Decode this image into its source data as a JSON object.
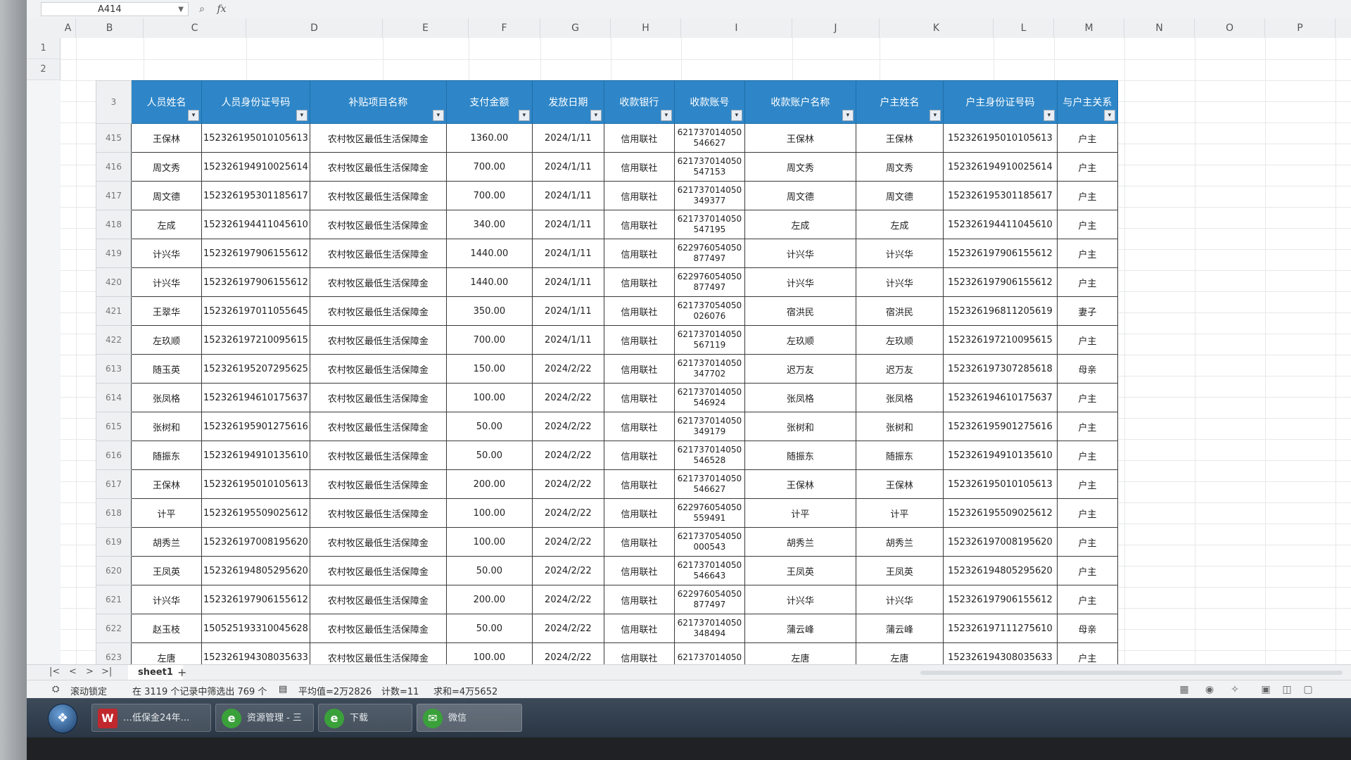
{
  "formula_bar": {
    "name_box": "A414",
    "zoom_icon": "magnifier-icon",
    "fx_label": "fx"
  },
  "columns": [
    "A",
    "B",
    "C",
    "D",
    "E",
    "F",
    "G",
    "H",
    "I",
    "J",
    "K",
    "L",
    "M",
    "N",
    "O",
    "P"
  ],
  "row_headers_top": [
    "1",
    "2",
    "3"
  ],
  "table": {
    "headers": [
      "人员姓名",
      "人员身份证号码",
      "补贴项目名称",
      "支付金额",
      "发放日期",
      "收款银行",
      "收款账号",
      "收款账户名称",
      "户主姓名",
      "户主身份证号码",
      "与户主关系"
    ],
    "rows": [
      {
        "rn": "415",
        "name": "王保林",
        "id": "152326195010105613",
        "item": "农村牧区最低生活保障金",
        "amount": "1360.00",
        "date": "2024/1/11",
        "bank": "信用联社",
        "acct1": "621737014050",
        "acct2": "546627",
        "acct_name": "王保林",
        "head": "王保林",
        "head_id": "152326195010105613",
        "rel": "户主"
      },
      {
        "rn": "416",
        "name": "周文秀",
        "id": "152326194910025614",
        "item": "农村牧区最低生活保障金",
        "amount": "700.00",
        "date": "2024/1/11",
        "bank": "信用联社",
        "acct1": "621737014050",
        "acct2": "547153",
        "acct_name": "周文秀",
        "head": "周文秀",
        "head_id": "152326194910025614",
        "rel": "户主"
      },
      {
        "rn": "417",
        "name": "周文德",
        "id": "152326195301185617",
        "item": "农村牧区最低生活保障金",
        "amount": "700.00",
        "date": "2024/1/11",
        "bank": "信用联社",
        "acct1": "621737014050",
        "acct2": "349377",
        "acct_name": "周文德",
        "head": "周文德",
        "head_id": "152326195301185617",
        "rel": "户主"
      },
      {
        "rn": "418",
        "name": "左成",
        "id": "152326194411045610",
        "item": "农村牧区最低生活保障金",
        "amount": "340.00",
        "date": "2024/1/11",
        "bank": "信用联社",
        "acct1": "621737014050",
        "acct2": "547195",
        "acct_name": "左成",
        "head": "左成",
        "head_id": "152326194411045610",
        "rel": "户主"
      },
      {
        "rn": "419",
        "name": "计兴华",
        "id": "152326197906155612",
        "item": "农村牧区最低生活保障金",
        "amount": "1440.00",
        "date": "2024/1/11",
        "bank": "信用联社",
        "acct1": "622976054050",
        "acct2": "877497",
        "acct_name": "计兴华",
        "head": "计兴华",
        "head_id": "152326197906155612",
        "rel": "户主"
      },
      {
        "rn": "420",
        "name": "计兴华",
        "id": "152326197906155612",
        "item": "农村牧区最低生活保障金",
        "amount": "1440.00",
        "date": "2024/1/11",
        "bank": "信用联社",
        "acct1": "622976054050",
        "acct2": "877497",
        "acct_name": "计兴华",
        "head": "计兴华",
        "head_id": "152326197906155612",
        "rel": "户主"
      },
      {
        "rn": "421",
        "name": "王翠华",
        "id": "152326197011055645",
        "item": "农村牧区最低生活保障金",
        "amount": "350.00",
        "date": "2024/1/11",
        "bank": "信用联社",
        "acct1": "621737054050",
        "acct2": "026076",
        "acct_name": "宿洪民",
        "head": "宿洪民",
        "head_id": "152326196811205619",
        "rel": "妻子"
      },
      {
        "rn": "422",
        "name": "左玖顺",
        "id": "152326197210095615",
        "item": "农村牧区最低生活保障金",
        "amount": "700.00",
        "date": "2024/1/11",
        "bank": "信用联社",
        "acct1": "621737014050",
        "acct2": "567119",
        "acct_name": "左玖顺",
        "head": "左玖顺",
        "head_id": "152326197210095615",
        "rel": "户主"
      },
      {
        "rn": "613",
        "name": "随玉英",
        "id": "152326195207295625",
        "item": "农村牧区最低生活保障金",
        "amount": "150.00",
        "date": "2024/2/22",
        "bank": "信用联社",
        "acct1": "621737014050",
        "acct2": "347702",
        "acct_name": "迟万友",
        "head": "迟万友",
        "head_id": "152326197307285618",
        "rel": "母亲"
      },
      {
        "rn": "614",
        "name": "张凤格",
        "id": "152326194610175637",
        "item": "农村牧区最低生活保障金",
        "amount": "100.00",
        "date": "2024/2/22",
        "bank": "信用联社",
        "acct1": "621737014050",
        "acct2": "546924",
        "acct_name": "张凤格",
        "head": "张凤格",
        "head_id": "152326194610175637",
        "rel": "户主"
      },
      {
        "rn": "615",
        "name": "张树和",
        "id": "152326195901275616",
        "item": "农村牧区最低生活保障金",
        "amount": "50.00",
        "date": "2024/2/22",
        "bank": "信用联社",
        "acct1": "621737014050",
        "acct2": "349179",
        "acct_name": "张树和",
        "head": "张树和",
        "head_id": "152326195901275616",
        "rel": "户主"
      },
      {
        "rn": "616",
        "name": "随振东",
        "id": "152326194910135610",
        "item": "农村牧区最低生活保障金",
        "amount": "50.00",
        "date": "2024/2/22",
        "bank": "信用联社",
        "acct1": "621737014050",
        "acct2": "546528",
        "acct_name": "随振东",
        "head": "随振东",
        "head_id": "152326194910135610",
        "rel": "户主"
      },
      {
        "rn": "617",
        "name": "王保林",
        "id": "152326195010105613",
        "item": "农村牧区最低生活保障金",
        "amount": "200.00",
        "date": "2024/2/22",
        "bank": "信用联社",
        "acct1": "621737014050",
        "acct2": "546627",
        "acct_name": "王保林",
        "head": "王保林",
        "head_id": "152326195010105613",
        "rel": "户主"
      },
      {
        "rn": "618",
        "name": "计平",
        "id": "152326195509025612",
        "item": "农村牧区最低生活保障金",
        "amount": "100.00",
        "date": "2024/2/22",
        "bank": "信用联社",
        "acct1": "622976054050",
        "acct2": "559491",
        "acct_name": "计平",
        "head": "计平",
        "head_id": "152326195509025612",
        "rel": "户主"
      },
      {
        "rn": "619",
        "name": "胡秀兰",
        "id": "152326197008195620",
        "item": "农村牧区最低生活保障金",
        "amount": "100.00",
        "date": "2024/2/22",
        "bank": "信用联社",
        "acct1": "621737054050",
        "acct2": "000543",
        "acct_name": "胡秀兰",
        "head": "胡秀兰",
        "head_id": "152326197008195620",
        "rel": "户主"
      },
      {
        "rn": "620",
        "name": "王凤英",
        "id": "152326194805295620",
        "item": "农村牧区最低生活保障金",
        "amount": "50.00",
        "date": "2024/2/22",
        "bank": "信用联社",
        "acct1": "621737014050",
        "acct2": "546643",
        "acct_name": "王凤英",
        "head": "王凤英",
        "head_id": "152326194805295620",
        "rel": "户主"
      },
      {
        "rn": "621",
        "name": "计兴华",
        "id": "152326197906155612",
        "item": "农村牧区最低生活保障金",
        "amount": "200.00",
        "date": "2024/2/22",
        "bank": "信用联社",
        "acct1": "622976054050",
        "acct2": "877497",
        "acct_name": "计兴华",
        "head": "计兴华",
        "head_id": "152326197906155612",
        "rel": "户主"
      },
      {
        "rn": "622",
        "name": "赵玉枝",
        "id": "150525193310045628",
        "item": "农村牧区最低生活保障金",
        "amount": "50.00",
        "date": "2024/2/22",
        "bank": "信用联社",
        "acct1": "621737014050",
        "acct2": "348494",
        "acct_name": "蒲云峰",
        "head": "蒲云峰",
        "head_id": "152326197111275610",
        "rel": "母亲"
      },
      {
        "rn": "623",
        "name": "左唐",
        "id": "152326194308035633",
        "item": "农村牧区最低生活保障金",
        "amount": "100.00",
        "date": "2024/2/22",
        "bank": "信用联社",
        "acct1": "621737014050",
        "acct2": "",
        "acct_name": "左唐",
        "head": "左唐",
        "head_id": "152326194308035633",
        "rel": "户主"
      }
    ]
  },
  "sheet_tabs": {
    "active": "sheet1",
    "add_label": "+",
    "nav": [
      "|<",
      "<",
      ">",
      ">|"
    ]
  },
  "status_bar": {
    "mode": "滚动锁定",
    "filter_info": "在 3119 个记录中筛选出 769 个",
    "average": "平均值=2万2826",
    "count": "计数=11",
    "sum": "求和=4万5652"
  },
  "taskbar": {
    "items": [
      {
        "label": "…低保金24年…",
        "icon": "wps-icon",
        "color": "#c0282d"
      },
      {
        "label": "资源管理 - 三务…",
        "icon": "ie-icon",
        "color": "#3aa13a"
      },
      {
        "label": "下载",
        "icon": "ie-icon",
        "color": "#3aa13a"
      },
      {
        "label": "微信",
        "icon": "wechat-icon",
        "color": "#3aa13a"
      }
    ]
  }
}
